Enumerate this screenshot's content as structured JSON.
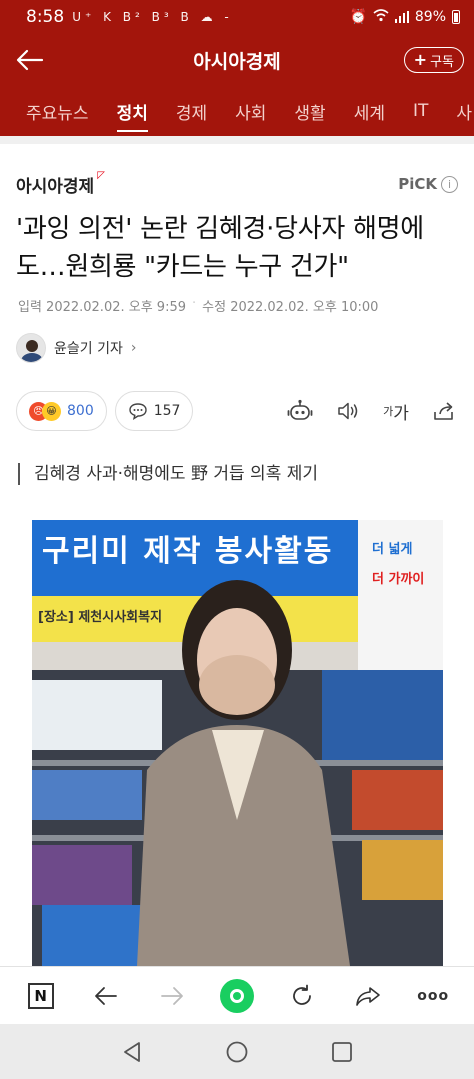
{
  "status_bar": {
    "time": "8:58",
    "left_icons": "U⁺ K B² B³ B ☁ -",
    "right_icons": "⏰ ⌂ ",
    "battery": "89%"
  },
  "app_bar": {
    "title": "아시아경제",
    "subscribe_label": "구독"
  },
  "nav_tabs": [
    {
      "label": "주요뉴스",
      "active": false
    },
    {
      "label": "정치",
      "active": true
    },
    {
      "label": "경제",
      "active": false
    },
    {
      "label": "사회",
      "active": false
    },
    {
      "label": "생활",
      "active": false
    },
    {
      "label": "세계",
      "active": false
    },
    {
      "label": "IT",
      "active": false
    },
    {
      "label": "사",
      "active": false
    }
  ],
  "article": {
    "press_name": "아시아경제",
    "pick_label": "PiCK",
    "headline": "'과잉 의전' 논란 김혜경·당사자 해명에도…원희룡 \"카드는 누구 건가\"",
    "published": "입력 2022.02.02. 오후 9:59",
    "modified": "수정 2022.02.02. 오후 10:00",
    "reporter": "윤슬기 기자",
    "reaction_count": "800",
    "comment_count": "157",
    "font_label_small": "가",
    "font_label_big": "가",
    "subtitle": "김혜경 사과·해명에도 野 거듭 의혹 제기",
    "photo_banner": "구리미 제작 봉사활동",
    "photo_place": "[장소]  제천시사회복지",
    "photo_side_1": "더 넓게",
    "photo_side_2": "더 가까이"
  },
  "colors": {
    "brand_red": "#a3150c",
    "naver_green": "#19ce60",
    "reaction_blue": "#3d6fd0"
  }
}
